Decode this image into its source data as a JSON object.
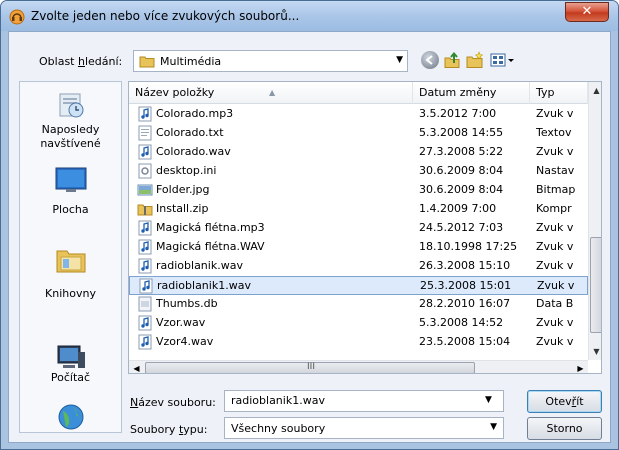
{
  "window": {
    "title": "Zvolte jeden nebo více zvukových souborů..."
  },
  "toolbar": {
    "lookin_label_pre": "Oblast ",
    "lookin_label_u": "h",
    "lookin_label_post": "ledání:",
    "lookin_value": "Multimédia"
  },
  "places": [
    {
      "label": "Naposledy navštívené",
      "icon": "recent-places-icon"
    },
    {
      "label": "Plocha",
      "icon": "desktop-icon"
    },
    {
      "label": "Knihovny",
      "icon": "libraries-icon"
    },
    {
      "label": "Počítač",
      "icon": "computer-icon"
    },
    {
      "label": "",
      "icon": "network-icon"
    }
  ],
  "columns": [
    "Název položky",
    "Datum změny",
    "Typ"
  ],
  "files": [
    {
      "name": "Colorado.mp3",
      "date": "3.5.2012 7:00",
      "type": "Zvuk v",
      "icon": "audio-file-icon"
    },
    {
      "name": "Colorado.txt",
      "date": "5.3.2008 14:55",
      "type": "Textov",
      "icon": "text-file-icon"
    },
    {
      "name": "Colorado.wav",
      "date": "27.3.2008 5:22",
      "type": "Zvuk v",
      "icon": "audio-file-icon"
    },
    {
      "name": "desktop.ini",
      "date": "30.6.2009 8:04",
      "type": "Nastav",
      "icon": "settings-file-icon"
    },
    {
      "name": "Folder.jpg",
      "date": "30.6.2009 8:04",
      "type": "Bitmap",
      "icon": "image-file-icon"
    },
    {
      "name": "Install.zip",
      "date": "1.4.2009 7:00",
      "type": "Kompr",
      "icon": "zip-file-icon"
    },
    {
      "name": "Magická flétna.mp3",
      "date": "24.5.2012 7:03",
      "type": "Zvuk v",
      "icon": "audio-file-icon"
    },
    {
      "name": "Magická flétna.WAV",
      "date": "18.10.1998 17:25",
      "type": "Zvuk v",
      "icon": "audio-file-icon"
    },
    {
      "name": "radioblanik.wav",
      "date": "26.3.2008 15:10",
      "type": "Zvuk v",
      "icon": "audio-file-icon"
    },
    {
      "name": "radioblanik1.wav",
      "date": "25.3.2008 15:01",
      "type": "Zvuk v",
      "icon": "audio-file-icon",
      "selected": true
    },
    {
      "name": "Thumbs.db",
      "date": "28.2.2010 16:07",
      "type": "Data B",
      "icon": "db-file-icon"
    },
    {
      "name": "Vzor.wav",
      "date": "5.3.2008 14:52",
      "type": "Zvuk v",
      "icon": "audio-file-icon"
    },
    {
      "name": "Vzor4.wav",
      "date": "23.5.2008 15:04",
      "type": "Zvuk v",
      "icon": "audio-file-icon"
    }
  ],
  "filename": {
    "label_u": "N",
    "label_post": "ázev souboru:",
    "value": "radioblanik1.wav"
  },
  "filetype": {
    "label_pre": "Soubory ",
    "label_u": "t",
    "label_post": "ypu:",
    "value": "Všechny soubory"
  },
  "buttons": {
    "open_pre": "Otev",
    "open_u": "ř",
    "open_post": "ít",
    "cancel": "Storno"
  },
  "scrollbar_grip": "III",
  "colors": {
    "selection_bg": "#dceafc",
    "selection_border": "#7da2ce",
    "window_frame": "#a9c3e1"
  }
}
